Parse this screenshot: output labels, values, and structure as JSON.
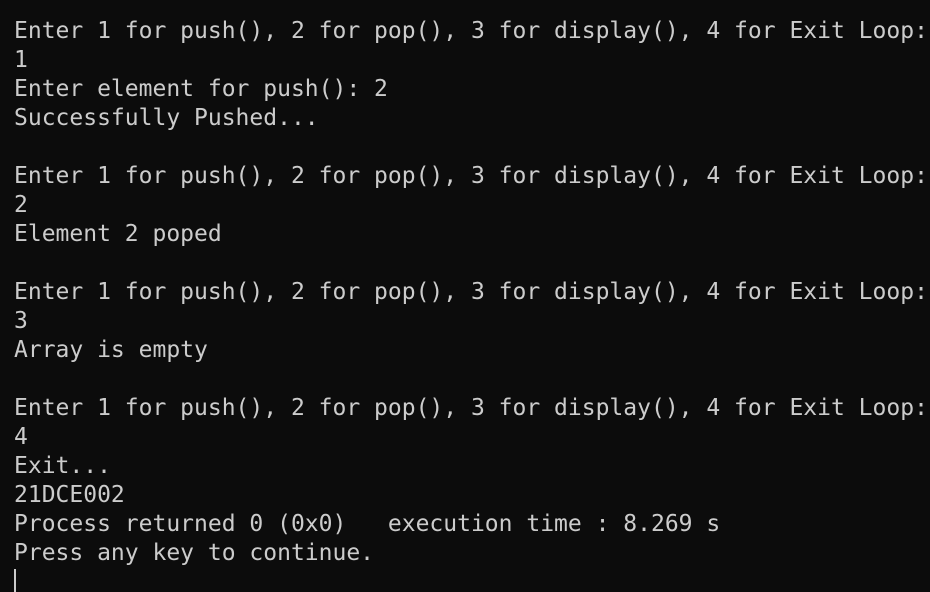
{
  "console": {
    "lines": [
      "Enter 1 for push(), 2 for pop(), 3 for display(), 4 for Exit Loop:",
      "1",
      "Enter element for push(): 2",
      "Successfully Pushed...",
      "",
      "Enter 1 for push(), 2 for pop(), 3 for display(), 4 for Exit Loop:",
      "2",
      "Element 2 poped",
      "",
      "Enter 1 for push(), 2 for pop(), 3 for display(), 4 for Exit Loop:",
      "3",
      "Array is empty",
      "",
      "Enter 1 for push(), 2 for pop(), 3 for display(), 4 for Exit Loop:",
      "4",
      "Exit...",
      "21DCE002",
      "Process returned 0 (0x0)   execution time : 8.269 s",
      "Press any key to continue."
    ]
  },
  "colors": {
    "background": "#0c0c0c",
    "text": "#cccccc"
  }
}
